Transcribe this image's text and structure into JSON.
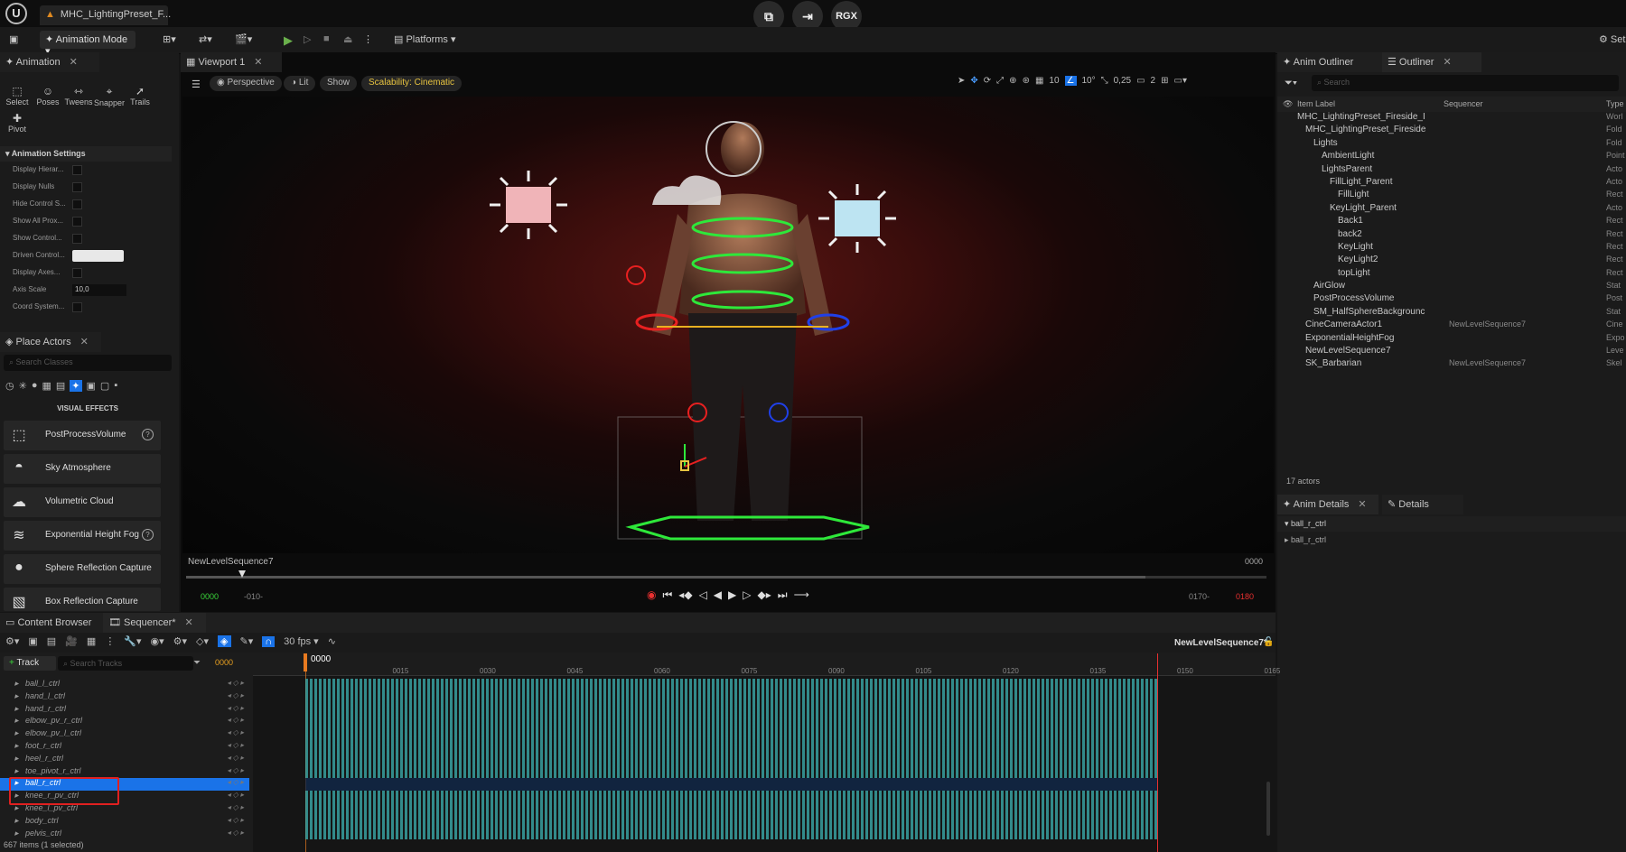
{
  "titlebar": {
    "doc_tab": "MHC_LightingPreset_F...",
    "center_badge": "RGX"
  },
  "toolbar": {
    "mode": "Animation Mode",
    "platforms": "Platforms",
    "settings": "Set"
  },
  "animation_panel": {
    "tab": "Animation",
    "tools": [
      "Select",
      "Poses",
      "Tweens",
      "Snapper",
      "Trails",
      "Pivot"
    ],
    "section": "Animation Settings",
    "props": [
      "Display Hierar...",
      "Display Nulls",
      "Hide Control S...",
      "Show All Prox...",
      "Show Control...",
      "Driven Control...",
      "Display Axes...",
      "Axis Scale",
      "Coord System..."
    ],
    "axis_scale_value": "10,0"
  },
  "place_actors": {
    "tab": "Place Actors",
    "search_placeholder": "Search Classes",
    "category": "VISUAL EFFECTS",
    "items": [
      "PostProcessVolume",
      "Sky Atmosphere",
      "Volumetric Cloud",
      "Exponential Height Fog",
      "Sphere Reflection Capture",
      "Box Reflection Capture"
    ]
  },
  "viewport": {
    "tab": "Viewport 1",
    "perspective": "Perspective",
    "lit": "Lit",
    "show": "Show",
    "scalability": "Scalability: Cinematic",
    "grid": "10",
    "angle": "10°",
    "scale": "0,25",
    "cams": "2",
    "sequence_name": "NewLevelSequence7",
    "frame_right": "0000",
    "start": "0000",
    "start_neg": "-010-",
    "end": "0170-",
    "end_red": "0180"
  },
  "outliner": {
    "tabs": [
      "Anim Outliner",
      "Outliner"
    ],
    "search_placeholder": "Search",
    "col_label": "Item Label",
    "col_seq": "Sequencer",
    "col_type": "Type",
    "rows": [
      {
        "label": "MHC_LightingPreset_Fireside_I",
        "seq": "",
        "type": "Worl",
        "indent": 0
      },
      {
        "label": "MHC_LightingPreset_Fireside",
        "seq": "",
        "type": "Fold",
        "indent": 1
      },
      {
        "label": "Lights",
        "seq": "",
        "type": "Fold",
        "indent": 2
      },
      {
        "label": "AmbientLight",
        "seq": "",
        "type": "Point",
        "indent": 3
      },
      {
        "label": "LightsParent",
        "seq": "",
        "type": "Acto",
        "indent": 3
      },
      {
        "label": "FillLight_Parent",
        "seq": "",
        "type": "Acto",
        "indent": 4
      },
      {
        "label": "FillLight",
        "seq": "",
        "type": "Rect",
        "indent": 5
      },
      {
        "label": "KeyLight_Parent",
        "seq": "",
        "type": "Acto",
        "indent": 4
      },
      {
        "label": "Back1",
        "seq": "",
        "type": "Rect",
        "indent": 5
      },
      {
        "label": "back2",
        "seq": "",
        "type": "Rect",
        "indent": 5
      },
      {
        "label": "KeyLight",
        "seq": "",
        "type": "Rect",
        "indent": 5
      },
      {
        "label": "KeyLight2",
        "seq": "",
        "type": "Rect",
        "indent": 5
      },
      {
        "label": "topLight",
        "seq": "",
        "type": "Rect",
        "indent": 5
      },
      {
        "label": "AirGlow",
        "seq": "",
        "type": "Stat",
        "indent": 2
      },
      {
        "label": "PostProcessVolume",
        "seq": "",
        "type": "Post",
        "indent": 2
      },
      {
        "label": "SM_HalfSphereBackgrounc",
        "seq": "",
        "type": "Stat",
        "indent": 2
      },
      {
        "label": "CineCameraActor1",
        "seq": "NewLevelSequence7",
        "type": "Cine",
        "indent": 1
      },
      {
        "label": "ExponentialHeightFog",
        "seq": "",
        "type": "Expo",
        "indent": 1
      },
      {
        "label": "NewLevelSequence7",
        "seq": "",
        "type": "Leve",
        "indent": 1
      },
      {
        "label": "SK_Barbarian",
        "seq": "NewLevelSequence7",
        "type": "Skel",
        "indent": 1
      }
    ],
    "actor_count": "17 actors"
  },
  "details": {
    "tabs": [
      "Anim Details",
      "Details"
    ],
    "rows": [
      "ball_r_ctrl",
      "ball_r_ctrl"
    ]
  },
  "bottom_tabs": [
    "Content Browser",
    "Sequencer*"
  ],
  "sequencer": {
    "fps": "30 fps",
    "sequence": "NewLevelSequence7*",
    "track_btn": "Track",
    "search_placeholder": "Search Tracks",
    "frame": "0000",
    "playhead": "0000",
    "ticks": [
      "0015",
      "0030",
      "0045",
      "0060",
      "0075",
      "0090",
      "0105",
      "0120",
      "0135",
      "0150",
      "0165"
    ],
    "tracks": [
      "ball_l_ctrl",
      "hand_l_ctrl",
      "hand_r_ctrl",
      "elbow_pv_r_ctrl",
      "elbow_pv_l_ctrl",
      "foot_r_ctrl",
      "heel_r_ctrl",
      "toe_pivot_r_ctrl",
      "ball_r_ctrl",
      "knee_r_pv_ctrl",
      "knee_l_pv_ctrl",
      "body_ctrl",
      "pelvis_ctrl"
    ],
    "selected": "ball_r_ctrl",
    "status": "667 items (1 selected)"
  },
  "colors": {
    "accent": "#1a73e8",
    "scalability": "#e8c440",
    "key": "#3aa8a8",
    "highlight_box": "#e02020"
  }
}
